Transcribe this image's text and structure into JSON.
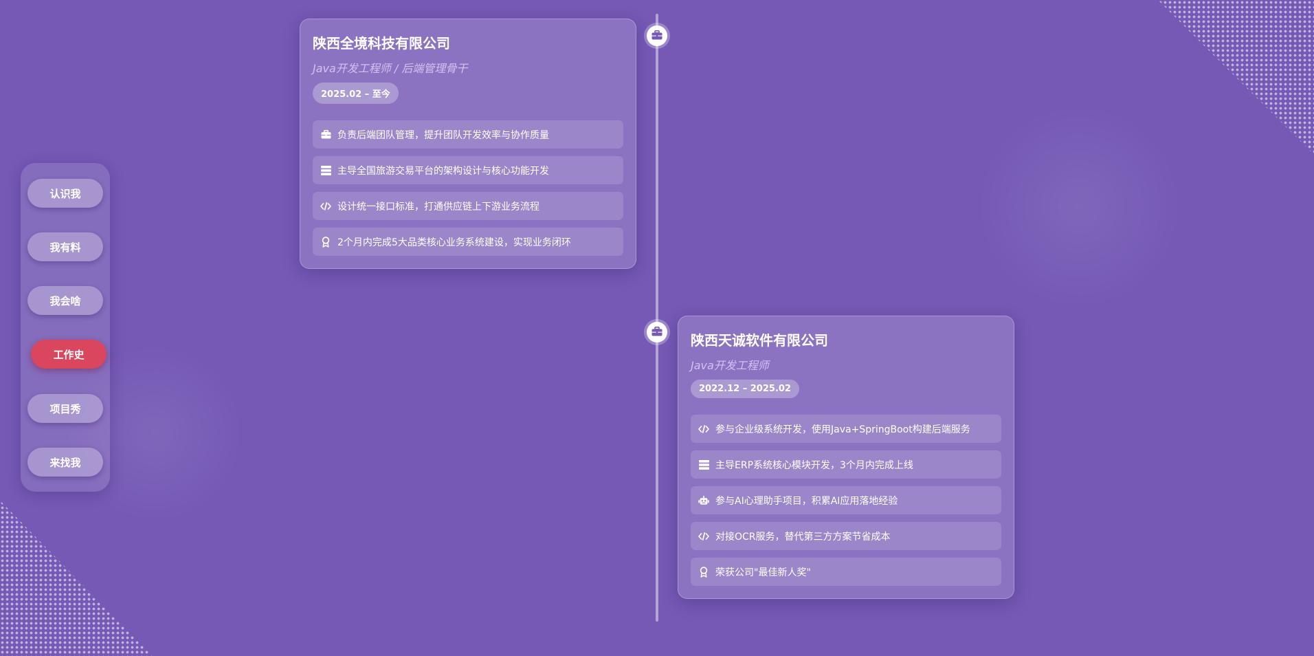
{
  "nav": {
    "items": [
      {
        "label": "认识我",
        "active": false
      },
      {
        "label": "我有料",
        "active": false
      },
      {
        "label": "我会啥",
        "active": false
      },
      {
        "label": "工作史",
        "active": true
      },
      {
        "label": "项目秀",
        "active": false
      },
      {
        "label": "来找我",
        "active": false
      }
    ]
  },
  "timeline": {
    "node_icon": "briefcase-icon",
    "jobs": [
      {
        "company": "陕西全境科技有限公司",
        "role": "Java开发工程师 / 后端管理骨干",
        "period": "2025.02 – 至今",
        "items": [
          {
            "icon": "briefcase-icon",
            "text": "负责后端团队管理，提升团队开发效率与协作质量"
          },
          {
            "icon": "server-icon",
            "text": "主导全国旅游交易平台的架构设计与核心功能开发"
          },
          {
            "icon": "code-icon",
            "text": "设计统一接口标准，打通供应链上下游业务流程"
          },
          {
            "icon": "award-icon",
            "text": "2个月内完成5大品类核心业务系统建设，实现业务闭环"
          }
        ]
      },
      {
        "company": "陕西天诚软件有限公司",
        "role": "Java开发工程师",
        "period": "2022.12 – 2025.02",
        "items": [
          {
            "icon": "code-icon",
            "text": "参与企业级系统开发，使用Java+SpringBoot构建后端服务"
          },
          {
            "icon": "server-icon",
            "text": "主导ERP系统核心模块开发，3个月内完成上线"
          },
          {
            "icon": "robot-icon",
            "text": "参与AI心理助手项目，积累AI应用落地经验"
          },
          {
            "icon": "code-icon",
            "text": "对接OCR服务，替代第三方方案节省成本"
          },
          {
            "icon": "award-icon",
            "text": "荣获公司\"最佳新人奖\""
          }
        ]
      }
    ]
  },
  "colors": {
    "background": "#7559b5",
    "active_nav": "#d9465e",
    "node_icon": "#7559b5"
  }
}
